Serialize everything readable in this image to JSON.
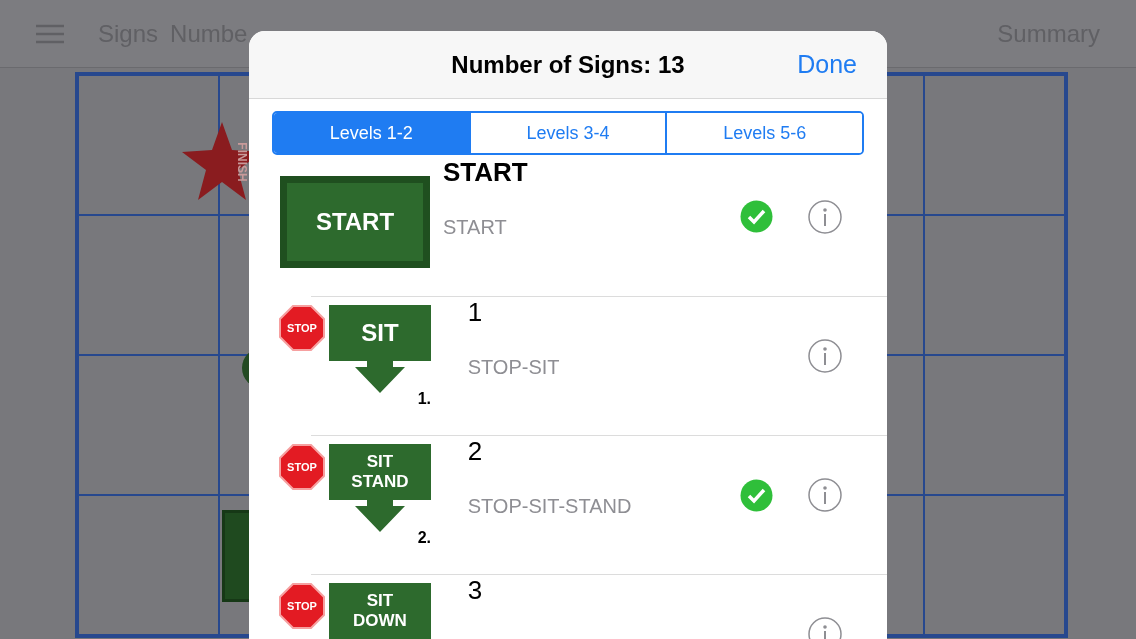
{
  "toolbar": {
    "items": [
      "Signs",
      "Numbe"
    ],
    "right": "Summary"
  },
  "course": {
    "finish_label": "FINISH"
  },
  "dialog": {
    "title": "Number of Signs: 13",
    "done": "Done",
    "segments": [
      {
        "label": "Levels 1-2",
        "selected": true
      },
      {
        "label": "Levels 3-4",
        "selected": false
      },
      {
        "label": "Levels 5-6",
        "selected": false
      }
    ],
    "signs": [
      {
        "title": "START",
        "subtitle": "START",
        "checked": true,
        "sign": {
          "kind": "start",
          "lines": [
            "START"
          ]
        }
      },
      {
        "title": "1",
        "subtitle": "STOP-SIT",
        "checked": false,
        "sign": {
          "kind": "stop-arrow",
          "stop": "STOP",
          "lines": [
            "SIT"
          ],
          "number": "1."
        }
      },
      {
        "title": "2",
        "subtitle": "STOP-SIT-STAND",
        "checked": true,
        "sign": {
          "kind": "stop-arrow",
          "stop": "STOP",
          "lines": [
            "SIT",
            "STAND"
          ],
          "number": "2."
        }
      },
      {
        "title": "3",
        "checked": false,
        "sign": {
          "kind": "stop-arrow",
          "stop": "STOP",
          "lines": [
            "SIT",
            "DOWN"
          ]
        }
      }
    ]
  }
}
